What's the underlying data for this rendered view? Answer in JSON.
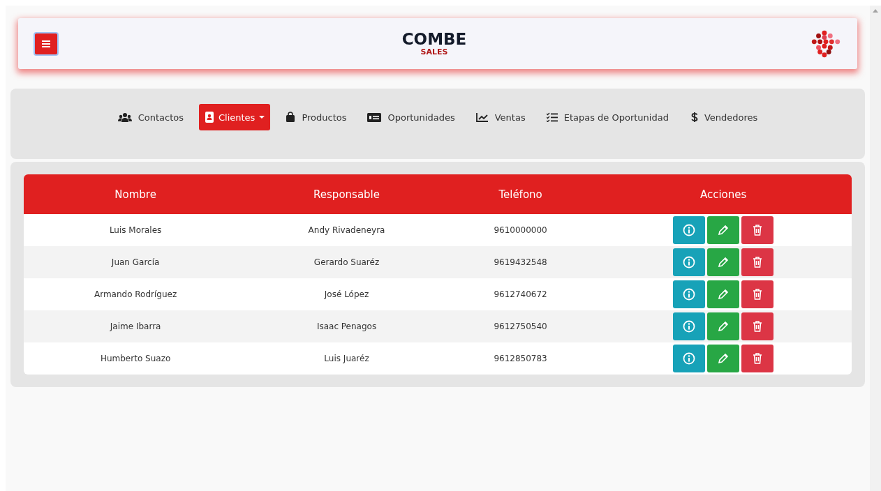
{
  "header": {
    "title": "COMBE",
    "subtitle": "SALES"
  },
  "nav": [
    {
      "label": "Contactos",
      "kind": "users",
      "selected": false,
      "dropdown": false
    },
    {
      "label": "Clientes",
      "kind": "contact-card",
      "selected": true,
      "dropdown": true
    },
    {
      "label": "Productos",
      "kind": "bag",
      "selected": false,
      "dropdown": false
    },
    {
      "label": "Oportunidades",
      "kind": "money",
      "selected": false,
      "dropdown": false
    },
    {
      "label": "Ventas",
      "kind": "chart",
      "selected": false,
      "dropdown": false
    },
    {
      "label": "Etapas de Oportunidad",
      "kind": "checklist",
      "selected": false,
      "dropdown": false
    },
    {
      "label": "Vendedores",
      "kind": "dollar",
      "selected": false,
      "dropdown": false
    }
  ],
  "table": {
    "columns": [
      "Nombre",
      "Responsable",
      "Teléfono",
      "Acciones"
    ],
    "rows": [
      [
        "Luis Morales",
        "Andy Rivadeneyra",
        "9610000000"
      ],
      [
        "Juan García",
        "Gerardo Suaréz",
        "9619432548"
      ],
      [
        "Armando Rodríguez",
        "José López",
        "9612740672"
      ],
      [
        "Jaime Ibarra",
        "Isaac Penagos",
        "9612750540"
      ],
      [
        "Humberto Suazo",
        "Luis Juaréz",
        "9612850783"
      ]
    ]
  }
}
